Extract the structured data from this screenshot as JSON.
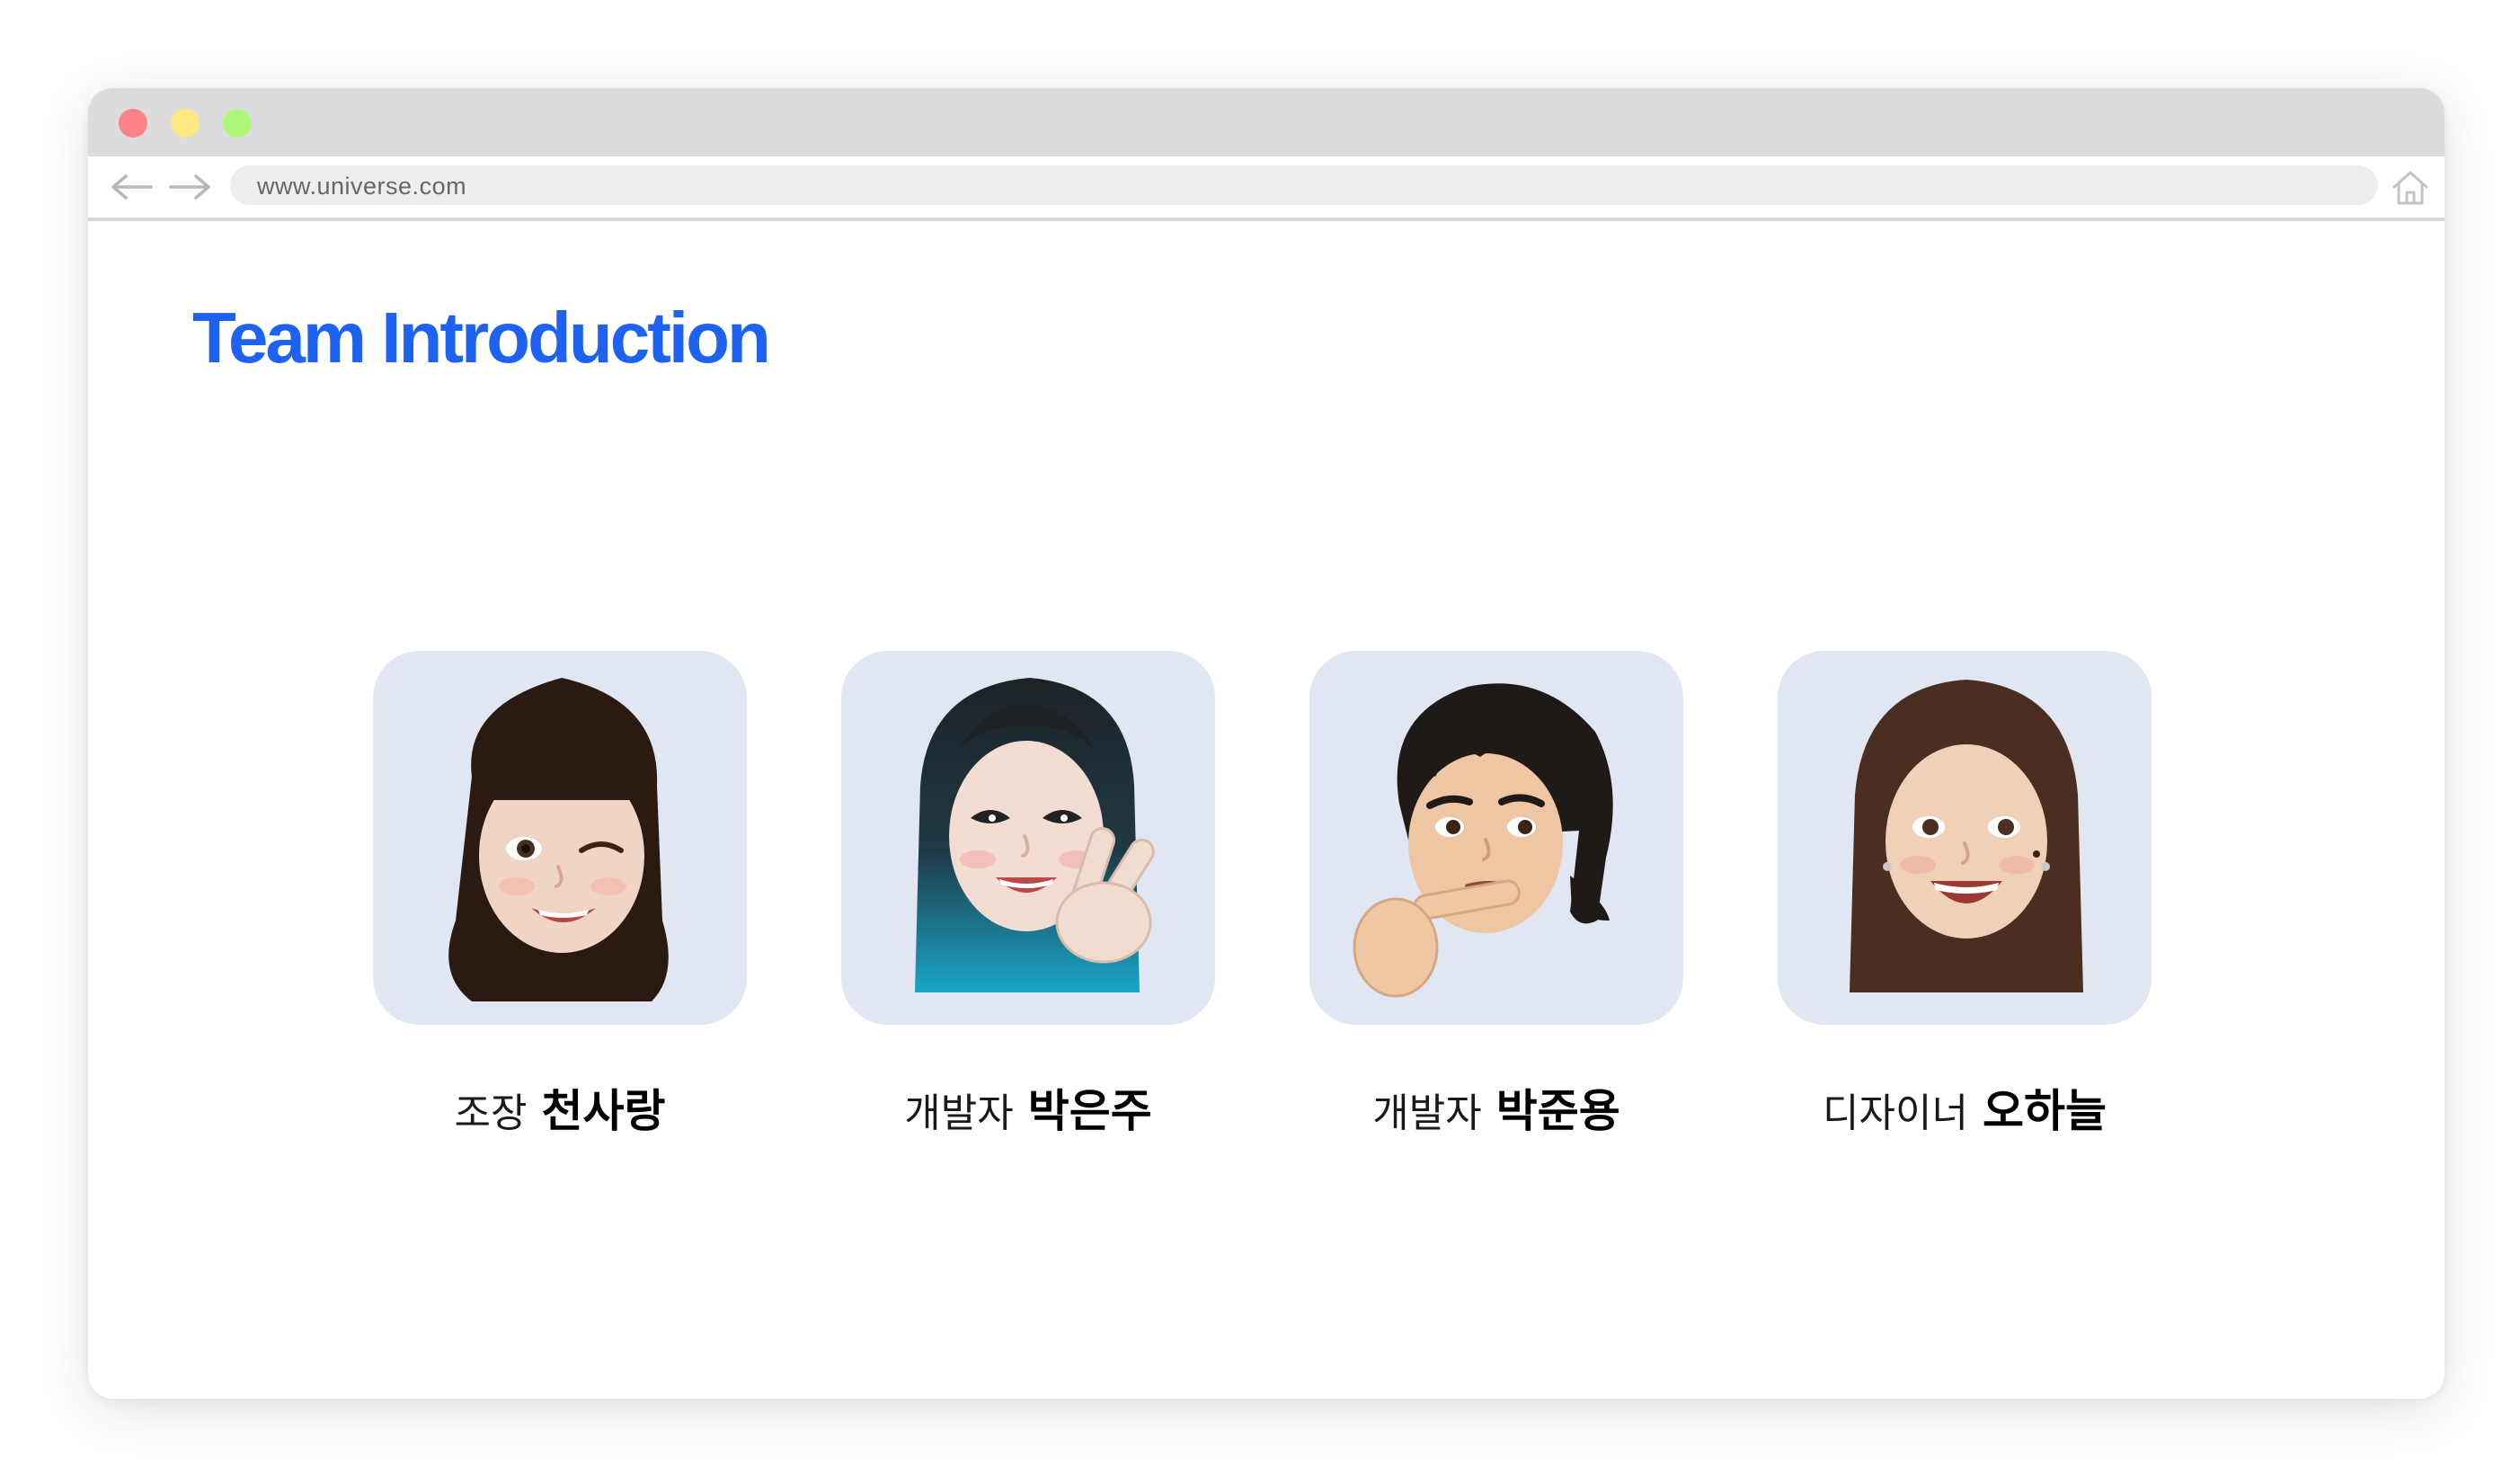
{
  "browser": {
    "url": "www.universe.com",
    "traffic_lights": [
      "#ff8189",
      "#ffe781",
      "#aef77a"
    ],
    "icons": [
      "back-arrow-icon",
      "forward-arrow-icon",
      "home-icon"
    ]
  },
  "page": {
    "title": "Team Introduction",
    "title_color": "#1e62f2"
  },
  "team": [
    {
      "role": "조장",
      "name": "천사랑",
      "avatar": "memoji-winking-girl-dark-hair"
    },
    {
      "role": "개발자",
      "name": "박은주",
      "avatar": "memoji-girl-blue-hair-peace-sign"
    },
    {
      "role": "개발자",
      "name": "박준용",
      "avatar": "memoji-boy-thinking"
    },
    {
      "role": "디자이너",
      "name": "오하늘",
      "avatar": "memoji-girl-brown-hair-smiling"
    }
  ]
}
